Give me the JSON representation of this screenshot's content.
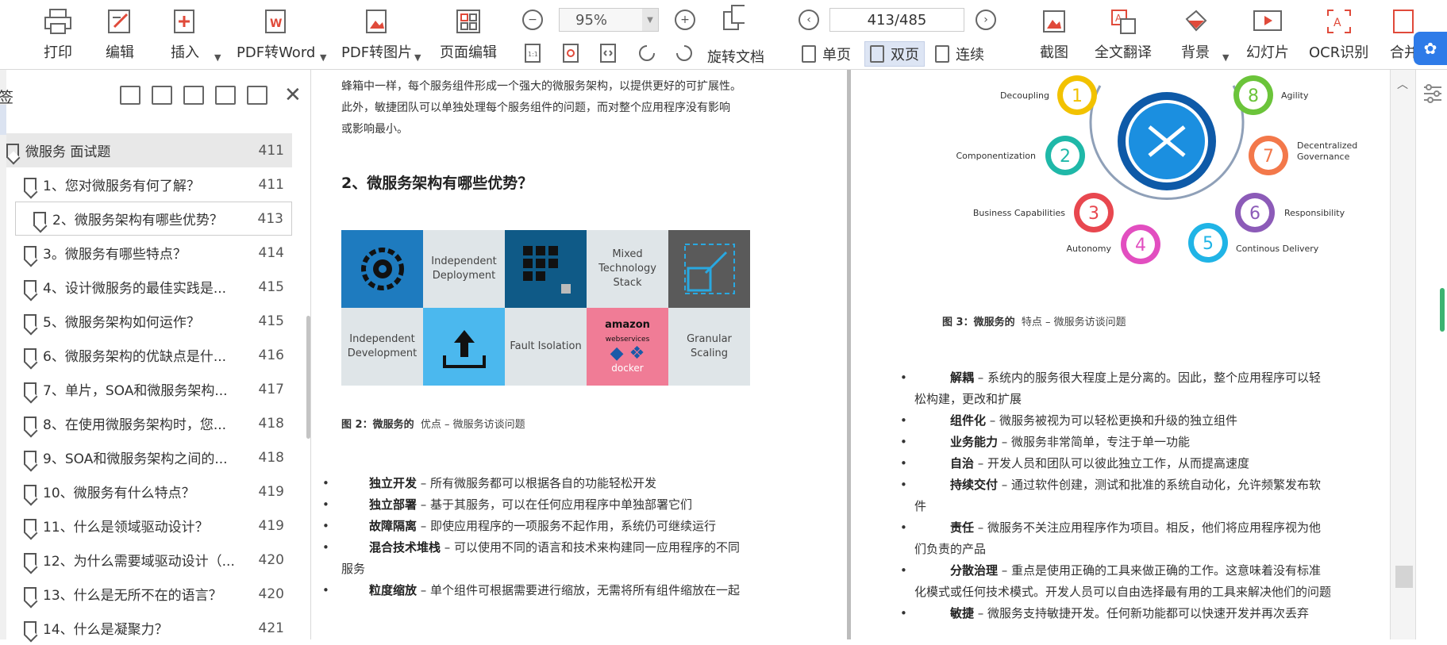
{
  "toolbar": {
    "print": "打印",
    "edit": "编辑",
    "insert": "插入",
    "pdf_to_word": "PDF转Word",
    "pdf_to_image": "PDF转图片",
    "page_edit": "页面编辑",
    "zoom": "95%",
    "rotate_doc": "旋转文档",
    "page_indicator": "413/485",
    "single_page": "单页",
    "double_page": "双页",
    "continuous": "连续",
    "screenshot": "截图",
    "full_translate": "全文翻译",
    "background": "背景",
    "slideshow": "幻灯片",
    "ocr": "OCR识别",
    "merge": "合并"
  },
  "sidebar": {
    "title": "签",
    "bookmarks": [
      {
        "label": "微服务 面试题",
        "page": "411"
      },
      {
        "label": "1、您对微服务有何了解？",
        "page": "411"
      },
      {
        "label": "2、微服务架构有哪些优势？",
        "page": "413"
      },
      {
        "label": "3。微服务有哪些特点？",
        "page": "414"
      },
      {
        "label": "4、设计微服务的最佳实践是...",
        "page": "415"
      },
      {
        "label": "5、微服务架构如何运作？",
        "page": "415"
      },
      {
        "label": "6、微服务架构的优缺点是什...",
        "page": "416"
      },
      {
        "label": "7、单片，SOA和微服务架构...",
        "page": "417"
      },
      {
        "label": "8、在使用微服务架构时，您...",
        "page": "418"
      },
      {
        "label": "9、SOA和微服务架构之间的...",
        "page": "418"
      },
      {
        "label": "10、微服务有什么特点？",
        "page": "419"
      },
      {
        "label": "11、什么是领域驱动设计？",
        "page": "419"
      },
      {
        "label": "12、为什么需要域驱动设计（...",
        "page": "420"
      },
      {
        "label": "13、什么是无所不在的语言？",
        "page": "420"
      },
      {
        "label": "14、什么是凝聚力？",
        "page": "421"
      }
    ]
  },
  "page1": {
    "intro_line1": "蜂箱中一样，每个服务组件形成一个强大的微服务架构，以提供更好的可扩展性。",
    "intro_line2": "此外，敏捷团队可以单独处理每个服务组件的问题，而对整个应用程序没有影响",
    "intro_line3": "或影响最小。",
    "heading": "2、微服务架构有哪些优势？",
    "figure_cells": {
      "independent_deployment": "Independent Deployment",
      "mixed_stack": "Mixed Technology Stack",
      "independent_development": "Independent Development",
      "fault_isolation": "Fault Isolation",
      "granular_scaling": "Granular Scaling",
      "amazon": "amazon",
      "webservices": "webservices",
      "docker": "docker"
    },
    "caption_bold": "图 2：微服务的",
    "caption_rest": "优点 – 微服务访谈问题",
    "bullets": [
      {
        "term": "独立开发",
        "desc": " – 所有微服务都可以根据各自的功能轻松开发"
      },
      {
        "term": "独立部署",
        "desc": " – 基于其服务，可以在任何应用程序中单独部署它们"
      },
      {
        "term": "故障隔离",
        "desc": " – 即使应用程序的一项服务不起作用，系统仍可继续运行"
      },
      {
        "term": "混合技术堆栈",
        "desc": " – 可以使用不同的语言和技术来构建同一应用程序的不同"
      },
      {
        "term": "粒度缩放",
        "desc": " – 单个组件可根据需要进行缩放，无需将所有组件缩放在一起"
      }
    ],
    "bullet_wrap": "服务"
  },
  "page2": {
    "figure_labels": [
      {
        "n": "1",
        "label": "Decoupling",
        "color": "#f2c200"
      },
      {
        "n": "2",
        "label": "Componentization",
        "color": "#1fb8a8"
      },
      {
        "n": "3",
        "label": "Business Capabilities",
        "color": "#e8474f"
      },
      {
        "n": "4",
        "label": "Autonomy",
        "color": "#e24ec0"
      },
      {
        "n": "5",
        "label": "Continous Delivery",
        "color": "#20b4e6"
      },
      {
        "n": "6",
        "label": "Responsibility",
        "color": "#8c5bb8"
      },
      {
        "n": "7",
        "label": "Decentralized Governance",
        "color": "#f3784a"
      },
      {
        "n": "8",
        "label": "Agility",
        "color": "#6bc43a"
      }
    ],
    "caption_bold": "图 3：微服务的",
    "caption_rest": "特点 – 微服务访谈问题",
    "bullets": [
      {
        "term": "解耦",
        "desc": " – 系统内的服务很大程度上是分离的。因此，整个应用程序可以轻",
        "wrap": "松构建，更改和扩展"
      },
      {
        "term": "组件化",
        "desc": " – 微服务被视为可以轻松更换和升级的独立组件",
        "wrap": ""
      },
      {
        "term": "业务能力",
        "desc": " – 微服务非常简单，专注于单一功能",
        "wrap": ""
      },
      {
        "term": "自治",
        "desc": " – 开发人员和团队可以彼此独立工作，从而提高速度",
        "wrap": ""
      },
      {
        "term": "持续交付",
        "desc": " – 通过软件创建，测试和批准的系统自动化，允许频繁发布软",
        "wrap": "件"
      },
      {
        "term": "责任",
        "desc": " – 微服务不关注应用程序作为项目。相反，他们将应用程序视为他",
        "wrap": "们负责的产品"
      },
      {
        "term": "分散治理",
        "desc": " – 重点是使用正确的工具来做正确的工作。这意味着没有标准",
        "wrap": "化模式或任何技术模式。开发人员可以自由选择最有用的工具来解决他们的问题"
      },
      {
        "term": "敏捷",
        "desc": " – 微服务支持敏捷开发。任何新功能都可以快速开发并再次丢弃",
        "wrap": ""
      }
    ]
  }
}
